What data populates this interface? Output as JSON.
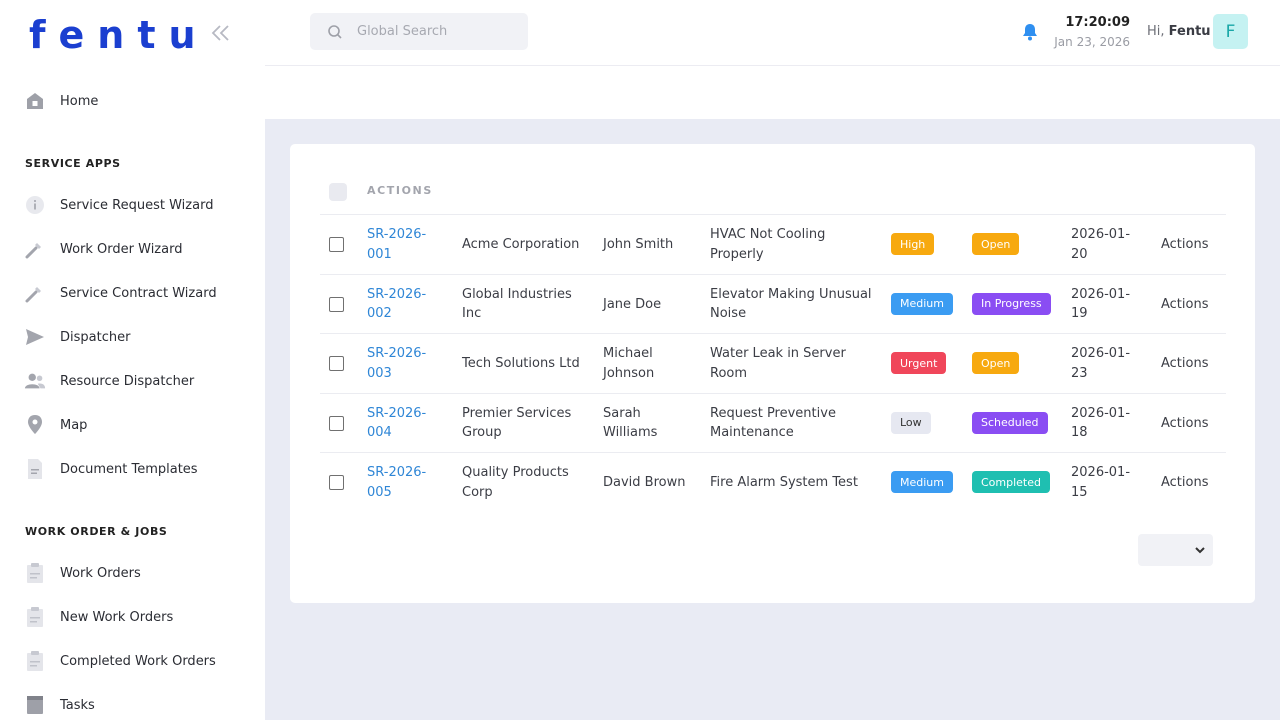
{
  "brand": {
    "logo_text": "fentu"
  },
  "sidebar": {
    "home": "Home",
    "section_service": "SERVICE APPS",
    "service_items": [
      {
        "label": "Service Request Wizard",
        "icon": "info-icon"
      },
      {
        "label": "Work Order Wizard",
        "icon": "wrench-icon"
      },
      {
        "label": "Service Contract Wizard",
        "icon": "wrench-icon"
      },
      {
        "label": "Dispatcher",
        "icon": "send-icon"
      },
      {
        "label": "Resource Dispatcher",
        "icon": "people-icon"
      },
      {
        "label": "Map",
        "icon": "map-pin-icon"
      },
      {
        "label": "Document Templates",
        "icon": "document-icon"
      }
    ],
    "section_work": "WORK ORDER & JOBS",
    "work_items": [
      {
        "label": "Work Orders",
        "icon": "clipboard-icon"
      },
      {
        "label": "New Work Orders",
        "icon": "clipboard-icon"
      },
      {
        "label": "Completed Work Orders",
        "icon": "clipboard-icon"
      },
      {
        "label": "Tasks",
        "icon": "tasks-icon"
      }
    ]
  },
  "header": {
    "search_placeholder": "Global Search",
    "time": "17:20:09",
    "date": "Jan 23, 2026",
    "greeting_prefix": "Hi,",
    "user_name": "Fentu",
    "avatar_letter": "F"
  },
  "table": {
    "header_label": "ACTIONS",
    "rows": [
      {
        "id_l1": "SR-2026-",
        "id_l2": "001",
        "company_l1": "Acme Corporation",
        "company_l2": "",
        "contact_l1": "John Smith",
        "contact_l2": "",
        "subject_l1": "HVAC Not Cooling",
        "subject_l2": "Properly",
        "priority": "High",
        "priority_color": "#f7a90f",
        "status": "Open",
        "status_color": "#f7a90f",
        "date_l1": "2026-01-",
        "date_l2": "20",
        "actions": "Actions"
      },
      {
        "id_l1": "SR-2026-",
        "id_l2": "002",
        "company_l1": "Global Industries",
        "company_l2": "Inc",
        "contact_l1": "Jane Doe",
        "contact_l2": "",
        "subject_l1": "Elevator Making Unusual",
        "subject_l2": "Noise",
        "priority": "Medium",
        "priority_color": "#3b9cf2",
        "status": "In Progress",
        "status_color": "#8a4df3",
        "date_l1": "2026-01-",
        "date_l2": "19",
        "actions": "Actions"
      },
      {
        "id_l1": "SR-2026-",
        "id_l2": "003",
        "company_l1": "Tech Solutions Ltd",
        "company_l2": "",
        "contact_l1": "Michael",
        "contact_l2": "Johnson",
        "subject_l1": "Water Leak in Server",
        "subject_l2": "Room",
        "priority": "Urgent",
        "priority_color": "#f0465a",
        "status": "Open",
        "status_color": "#f7a90f",
        "date_l1": "2026-01-",
        "date_l2": "23",
        "actions": "Actions"
      },
      {
        "id_l1": "SR-2026-",
        "id_l2": "004",
        "company_l1": "Premier Services",
        "company_l2": "Group",
        "contact_l1": "Sarah",
        "contact_l2": "Williams",
        "subject_l1": "Request Preventive",
        "subject_l2": "Maintenance",
        "priority": "Low",
        "priority_color": "#e6e8f1",
        "status": "Scheduled",
        "status_color": "#8a4df3",
        "date_l1": "2026-01-",
        "date_l2": "18",
        "actions": "Actions"
      },
      {
        "id_l1": "SR-2026-",
        "id_l2": "005",
        "company_l1": "Quality Products",
        "company_l2": "Corp",
        "contact_l1": "David Brown",
        "contact_l2": "",
        "subject_l1": "Fire Alarm System Test",
        "subject_l2": "",
        "priority": "Medium",
        "priority_color": "#3b9cf2",
        "status": "Completed",
        "status_color": "#1fbfb1",
        "date_l1": "2026-01-",
        "date_l2": "15",
        "actions": "Actions"
      }
    ]
  }
}
